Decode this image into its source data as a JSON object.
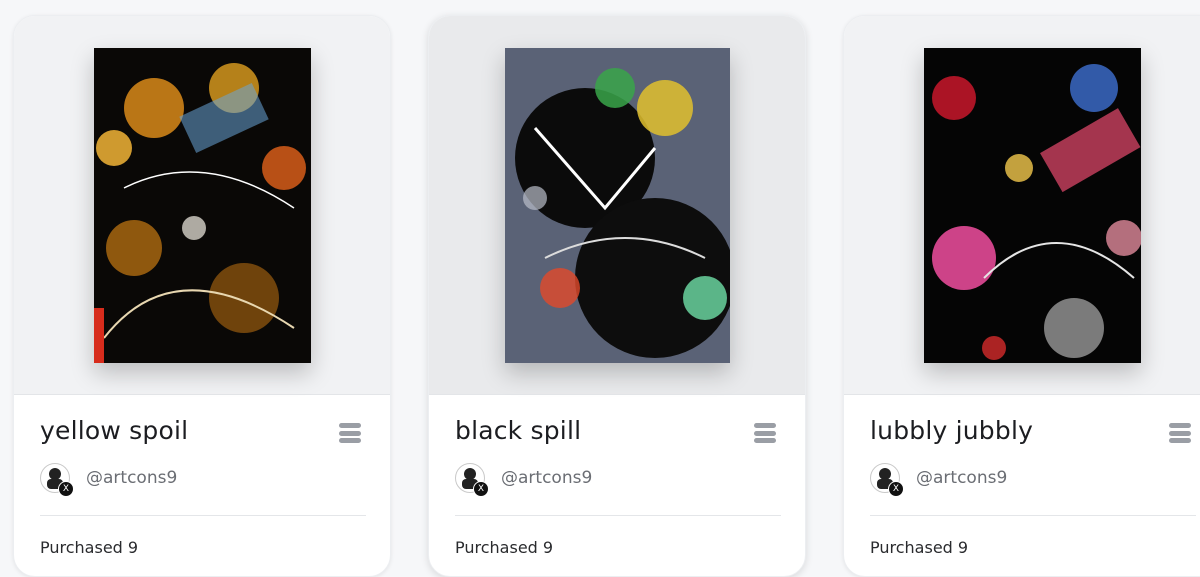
{
  "cards": [
    {
      "title": "yellow spoil",
      "creator": "@artcons9",
      "footer": "Purchased 9"
    },
    {
      "title": "black spill",
      "creator": "@artcons9",
      "footer": "Purchased 9"
    },
    {
      "title": "lubbly jubbly",
      "creator": "@artcons9",
      "footer": "Purchased 9"
    }
  ],
  "icons": {
    "menu": "menu-icon",
    "badge": "x-logo-icon"
  },
  "colors": {
    "title_text": "#1c1d21",
    "handle_text": "#6b6e74",
    "menu_icon": "#9a9ea5"
  }
}
